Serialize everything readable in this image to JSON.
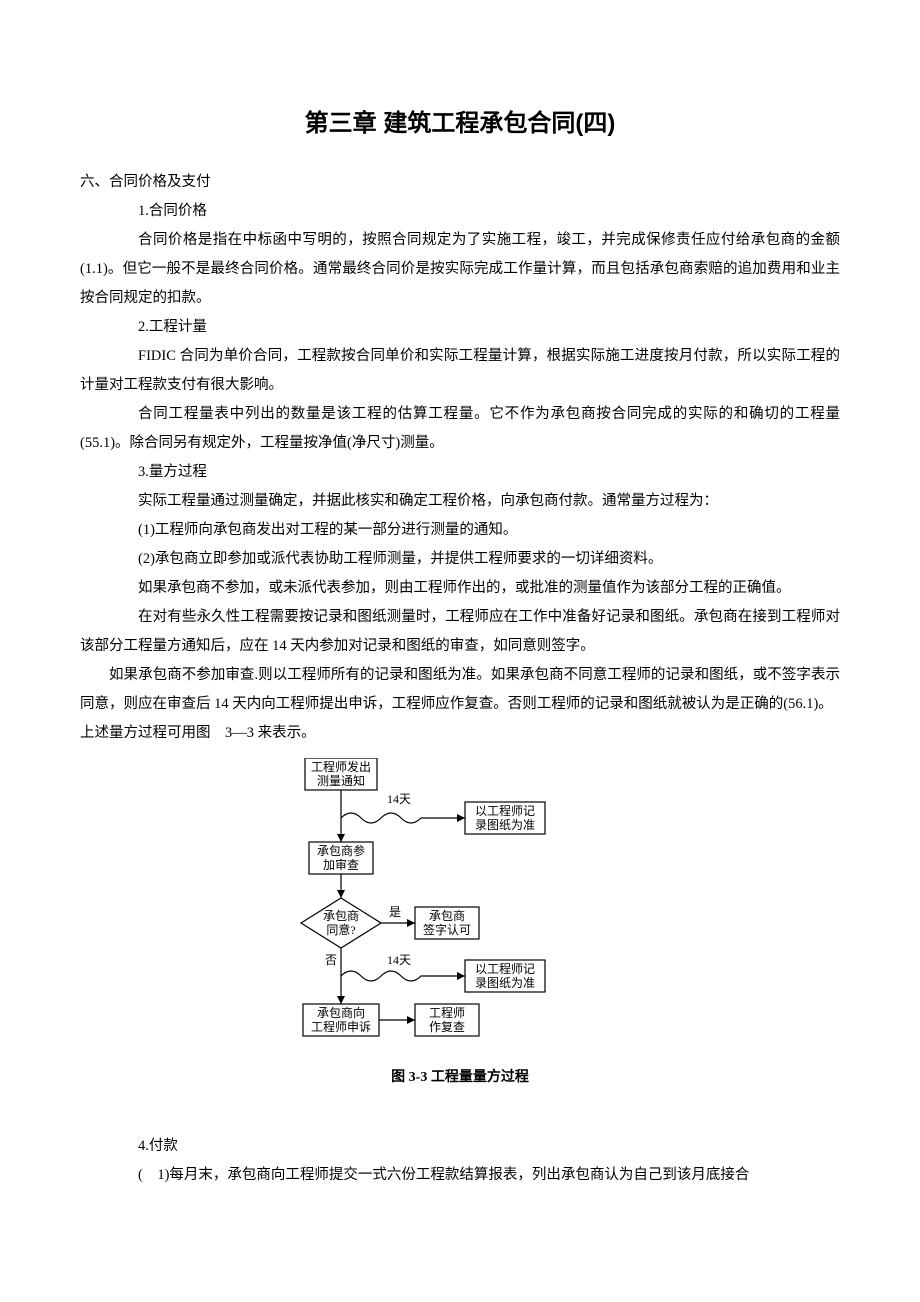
{
  "title": "第三章 建筑工程承包合同(四)",
  "section_heading": "六、合同价格及支付",
  "s1": {
    "head": "1.合同价格",
    "p1": "合同价格是指在中标函中写明的，按照合同规定为了实施工程，竣工，并完成保修责任应付给承包商的金额(1.1)。但它一般不是最终合同价格。通常最终合同价是按实际完成工作量计算，而且包括承包商索赔的追加费用和业主按合同规定的扣款。"
  },
  "s2": {
    "head": "2.工程计量",
    "p1": "FIDIC 合同为单价合同，工程款按合同单价和实际工程量计算，根据实际施工进度按月付款，所以实际工程的计量对工程款支付有很大影响。",
    "p2": "合同工程量表中列出的数量是该工程的估算工程量。它不作为承包商按合同完成的实际的和确切的工程量(55.1)。除合同另有规定外，工程量按净值(净尺寸)测量。"
  },
  "s3": {
    "head": "3.量方过程",
    "p1": "实际工程量通过测量确定，并据此核实和确定工程价格，向承包商付款。通常量方过程为：",
    "p2": "(1)工程师向承包商发出对工程的某一部分进行测量的通知。",
    "p3": "(2)承包商立即参加或派代表协助工程师测量，并提供工程师要求的一切详细资料。",
    "p4": "如果承包商不参加，或未派代表参加，则由工程师作出的，或批准的测量值作为该部分工程的正确值。",
    "p5": "在对有些永久性工程需要按记录和图纸测量时，工程师应在工作中准备好记录和图纸。承包商在接到工程师对该部分工程量方通知后，应在 14 天内参加对记录和图纸的审查，如同意则签字。",
    "p6": "如果承包商不参加审查.则以工程师所有的记录和图纸为准。如果承包商不同意工程师的记录和图纸，或不签字表示同意，则应在审查后 14 天内向工程师提出申诉，工程师应作复查。否则工程师的记录和图纸就被认为是正确的(56.1)。",
    "p7": "上述量方过程可用图　3—3 来表示。"
  },
  "figure": {
    "caption": "图 3-3 工程量量方过程",
    "box1a": "工程师发出",
    "box1b": "测量通知",
    "note14a": "14天",
    "out1a": "以工程师记",
    "out1b": "录图纸为准",
    "box2a": "承包商参",
    "box2b": "加审查",
    "diamond_a": "承包商",
    "diamond_b": "同意?",
    "yes": "是",
    "no": "否",
    "box3a": "承包商",
    "box3b": "签字认可",
    "note14b": "14天",
    "out2a": "以工程师记",
    "out2b": "录图纸为准",
    "box4a": "承包商向",
    "box4b": "工程师申诉",
    "box5a": "工程师",
    "box5b": "作复查"
  },
  "s4": {
    "head": "4.付款",
    "p1": "(　1)每月末，承包商向工程师提交一式六份工程款结算报表，列出承包商认为自己到该月底接合"
  }
}
